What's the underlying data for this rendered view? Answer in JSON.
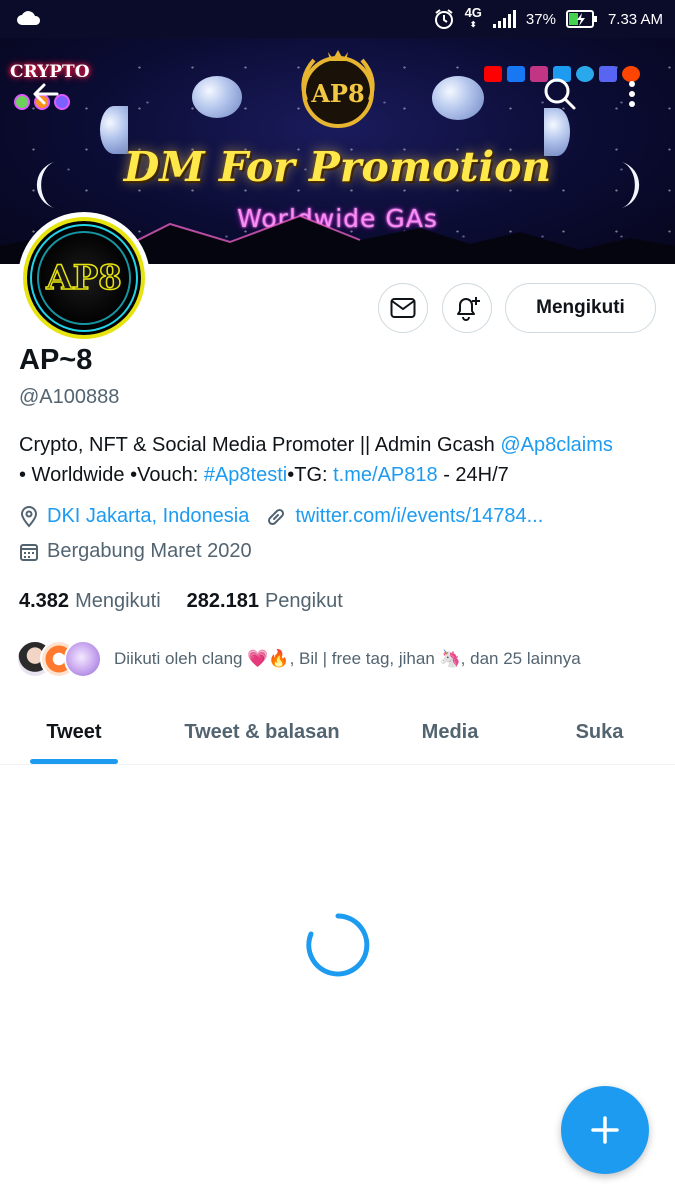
{
  "status_bar": {
    "network": "4G",
    "battery": "37%",
    "time": "7.33 AM"
  },
  "banner": {
    "crypto_tag": "CRYPTO",
    "logo_text": "AP8",
    "headline": "DM For Promotion",
    "subline": "Worldwide GAs"
  },
  "profile": {
    "avatar_text": "AP8",
    "name": "AP~8",
    "handle": "@A100888",
    "bio_line1_text": "Crypto, NFT & Social Media Promoter || Admin Gcash ",
    "bio_line1_link": "@Ap8claims",
    "bio_line2_prefix": "• Worldwide •Vouch: ",
    "bio_line2_hashtag": "#Ap8testi",
    "bio_line2_mid": "•TG: ",
    "bio_line2_link": "t.me/AP818",
    "bio_line2_suffix": " - 24H/7",
    "location": "DKI Jakarta, Indonesia",
    "website": "twitter.com/i/events/14784...",
    "joined": "Bergabung Maret 2020",
    "following_count": "4.382",
    "following_label": "Mengikuti",
    "followers_count": "282.181",
    "followers_label": "Pengikut",
    "followed_by": "Diikuti oleh clang 💗🔥, Bil | free tag, jihan 🦄, dan 25 lainnya"
  },
  "actions": {
    "follow_label": "Mengikuti"
  },
  "tabs": [
    {
      "label": "Tweet"
    },
    {
      "label": "Tweet & balasan"
    },
    {
      "label": "Media"
    },
    {
      "label": "Suka"
    }
  ],
  "colors": {
    "accent": "#1d9bf0",
    "text": "#0f1419",
    "muted": "#536471"
  }
}
